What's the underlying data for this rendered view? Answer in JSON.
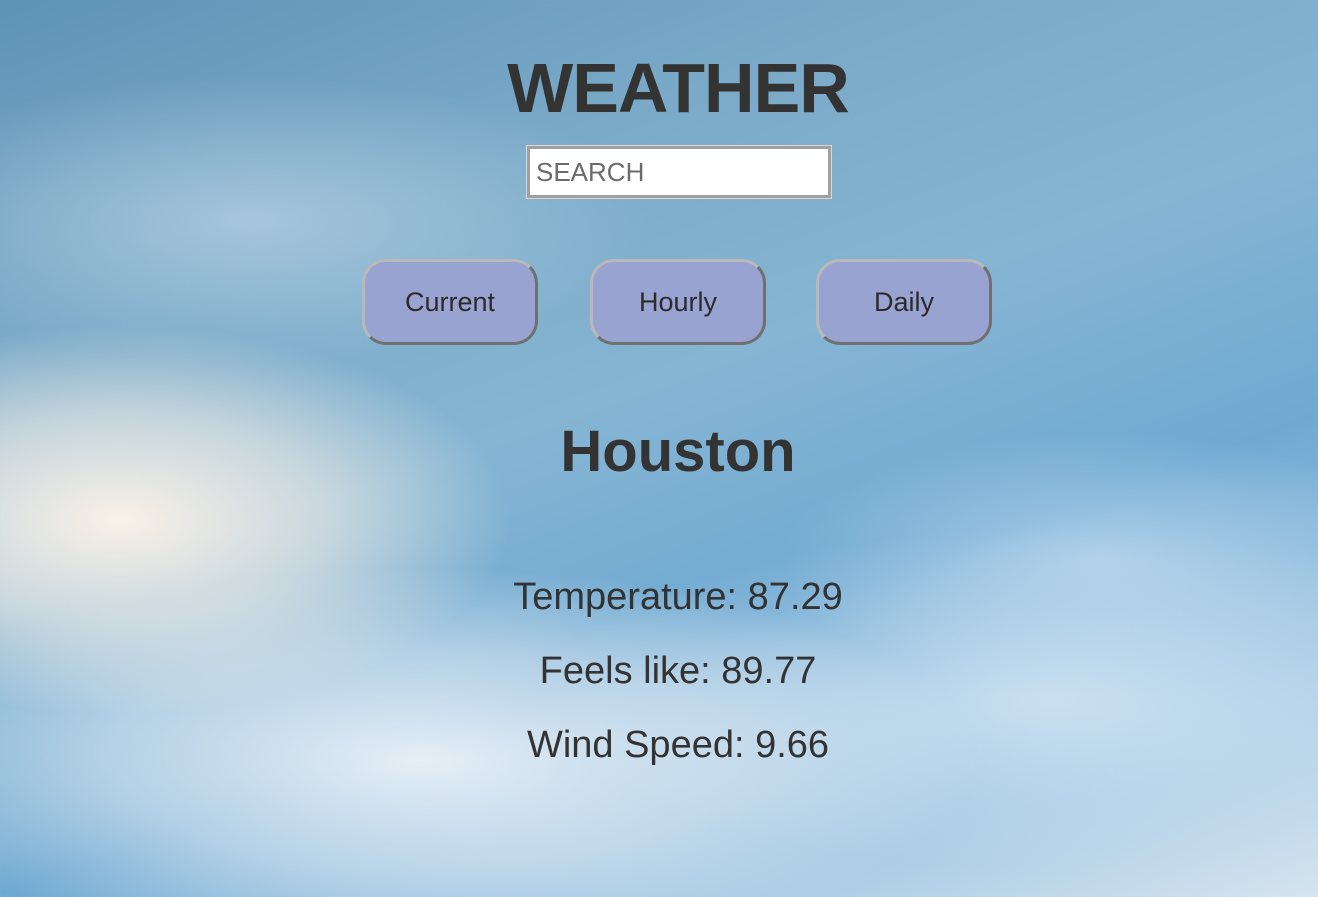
{
  "header": {
    "title": "WEATHER"
  },
  "search": {
    "placeholder": "SEARCH",
    "value": ""
  },
  "tabs": [
    {
      "label": "Current"
    },
    {
      "label": "Hourly"
    },
    {
      "label": "Daily"
    }
  ],
  "location": {
    "city": "Houston"
  },
  "weather": {
    "temperature": "Temperature: 87.29",
    "feels_like": "Feels like: 89.77",
    "wind_speed": "Wind Speed: 9.66"
  },
  "colors": {
    "button_fill": "#98a3d1",
    "text": "#333333"
  }
}
